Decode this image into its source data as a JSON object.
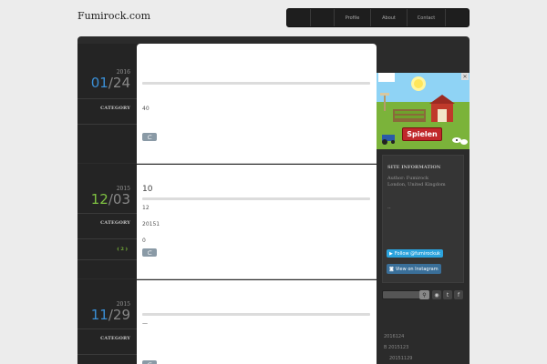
{
  "site": {
    "title": "Fumirock.com"
  },
  "nav": {
    "items": [
      "",
      "",
      "Profile",
      "About",
      "Contact",
      ""
    ]
  },
  "posts": [
    {
      "year": "2016",
      "month": "01",
      "day": "24",
      "month_color": "#3a8fd6",
      "category_label": "CATEGORY",
      "title": "",
      "lines": [
        "40"
      ],
      "comments": ""
    },
    {
      "year": "2015",
      "month": "12",
      "day": "03",
      "month_color": "#7fc242",
      "category_label": "CATEGORY",
      "title": "10",
      "lines": [
        "12",
        "20151",
        "0"
      ],
      "comments": "( 2 )"
    },
    {
      "year": "2015",
      "month": "11",
      "day": "29",
      "month_color": "#3a8fd6",
      "category_label": "CATEGORY",
      "title": "",
      "lines": [
        "—"
      ],
      "comments": ""
    }
  ],
  "more_glyph": "⊂",
  "ad": {
    "close": "✕",
    "cta": "Spielen"
  },
  "site_info": {
    "heading": "SITE INFORMATION",
    "author": "Author: Fumirock",
    "location": "London, United Kingdom",
    "dash": "--",
    "twitter_button": "Follow @fumirockuk",
    "instagram_button": "View on Instagram"
  },
  "search": {
    "go_icon": "search-icon",
    "go_glyph": "⚲"
  },
  "social": [
    {
      "name": "rss-icon",
      "glyph": "◉"
    },
    {
      "name": "twitter-icon",
      "glyph": "t"
    },
    {
      "name": "facebook-icon",
      "glyph": "f"
    }
  ],
  "archive": [
    "2016124",
    "B 2015123",
    "20151129"
  ]
}
